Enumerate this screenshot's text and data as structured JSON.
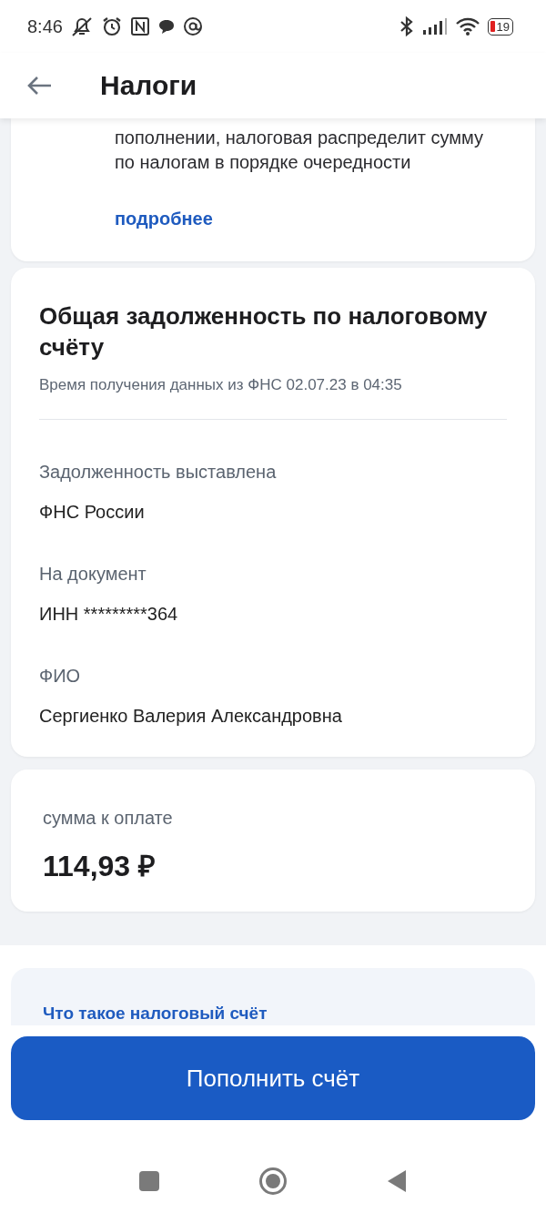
{
  "status_bar": {
    "time": "8:46",
    "battery": "19"
  },
  "header": {
    "title": "Налоги"
  },
  "notice": {
    "text": "пополнении, налоговая распределит сумму по налогам в порядке очередности",
    "link": "подробнее"
  },
  "debt_card": {
    "title": "Общая задолженность по налоговому счёту",
    "updated": "Время получения данных из ФНС 02.07.23 в 04:35",
    "fields": [
      {
        "label": "Задолженность выставлена",
        "value": "ФНС России"
      },
      {
        "label": "На документ",
        "value": "ИНН *********364"
      },
      {
        "label": "ФИО",
        "value": "Сергиенко Валерия Александровна"
      }
    ]
  },
  "amount_card": {
    "label": "сумма к оплате",
    "amount": "114,93 ₽"
  },
  "info": {
    "link": "Что такое налоговый счёт"
  },
  "primary_button": "Пополнить счёт"
}
